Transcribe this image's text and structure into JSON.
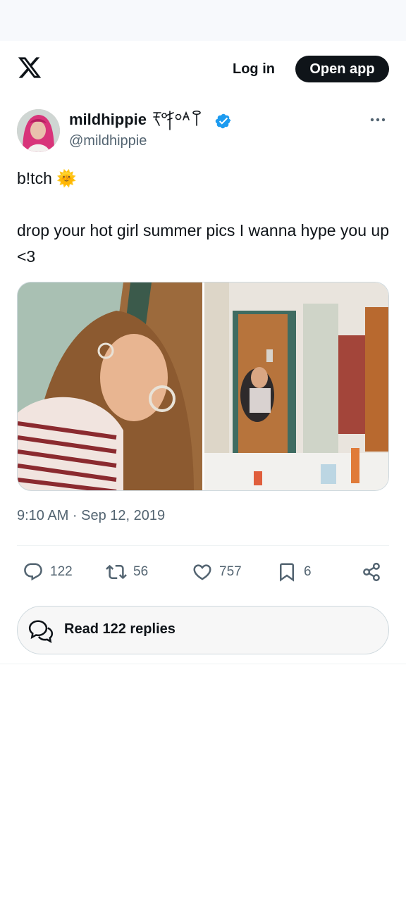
{
  "header": {
    "login_label": "Log in",
    "open_app_label": "Open app",
    "logo_icon": "x-logo-icon"
  },
  "tweet": {
    "author": {
      "display_name": "mildhippie",
      "name_decoration": "ༀༀༀ",
      "handle": "@mildhippie",
      "verified": true,
      "verified_color": "#1d9bf0"
    },
    "text_line1": "b!tch 🌞",
    "text_line2": "drop your hot girl summer pics I wanna hype you up <3",
    "timestamp": "9:10 AM · Sep 12, 2019",
    "media_count": 2,
    "stats": {
      "replies": "122",
      "reposts": "56",
      "likes": "757",
      "bookmarks": "6"
    },
    "read_replies_label": "Read 122 replies"
  },
  "colors": {
    "text_primary": "#0f1419",
    "text_secondary": "#536471",
    "accent": "#1d9bf0",
    "button_dark": "#0f1419"
  }
}
